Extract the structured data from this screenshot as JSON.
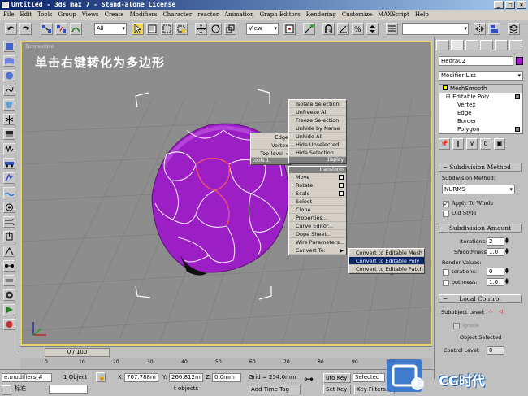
{
  "window": {
    "title": "Untitled - 3ds max 7  - Stand-alone License"
  },
  "menu": [
    "File",
    "Edit",
    "Tools",
    "Group",
    "Views",
    "Create",
    "Modifiers",
    "Character",
    "reactor",
    "Animation",
    "Graph Editors",
    "Rendering",
    "Customize",
    "MAXScript",
    "Help"
  ],
  "toolbar": {
    "selection_filter": "All",
    "reference_coord": "View"
  },
  "viewport": {
    "label": "Perspective",
    "caption": "单击右键转化为多边形"
  },
  "quad_left": [
    "Edge",
    "Vertex",
    "Top-level",
    "tools 1"
  ],
  "quad_top": [
    "Isolate Selection",
    "Unfreeze All",
    "Freeze Selection",
    "Unhide by Name",
    "Unhide All",
    "Hide Unselected",
    "Hide Selection",
    "display"
  ],
  "quad_bottom_header": "transform",
  "quad_bottom": [
    "Move",
    "Rotate",
    "Scale",
    "Select",
    "Clone",
    "Properties...",
    "Curve Editor...",
    "Dope Sheet...",
    "Wire Parameters...",
    "Convert To:"
  ],
  "submenu": [
    "Convert to Editable Mesh",
    "Convert to Editable Poly",
    "Convert to Editable Patch"
  ],
  "cmdpanel": {
    "object_name": "Hedra02",
    "object_color": "#a020c8",
    "modifier_list": "Modifier List",
    "stack": [
      "MeshSmooth",
      "Editable Poly",
      "Vertex",
      "Edge",
      "Border",
      "Polygon"
    ],
    "roll_subdivision_method": "Subdivision Method",
    "subdivision_method_label": "Subdivision Method:",
    "subdivision_method_value": "NURMS",
    "apply_to_whole": "Apply To Whole",
    "old_style": "Old Style",
    "roll_subdivision_amount": "Subdivision Amount",
    "iterations_label": "Iterations:",
    "iterations_value": "2",
    "smoothness_label": "Smoothness:",
    "smoothness_value": "1.0",
    "render_values": "Render Values:",
    "r_iterations_label": "terations:",
    "r_iterations_value": "0",
    "r_smoothness_label": "oothness:",
    "r_smoothness_value": "1.0",
    "roll_local_control": "Local Control",
    "subobject_level": "Subobject Level:",
    "ignore": "Ignore",
    "object_selected": "Object Selected",
    "control_level": "Control Level:",
    "control_level_value": "0"
  },
  "timeline": {
    "slider": "0 / 100",
    "ticks": [
      "0",
      "10",
      "20",
      "30",
      "40",
      "50",
      "60",
      "70",
      "80",
      "90",
      "100"
    ]
  },
  "status": {
    "script": "e.modifiers[#",
    "objects": "1 Object",
    "x_label": "X:",
    "x_value": "707.788m",
    "y_label": "Y:",
    "y_value": "266.812m",
    "z_label": "Z:",
    "z_value": "0.0mm",
    "grid": "Grid = 254.0mm",
    "auto_key": "uto Key",
    "selected": "Selected",
    "set_key": "Set Key",
    "key_filters": "Key Filters...",
    "prompt_left": "标准",
    "prompt_mid": "t objects",
    "add_time_tag": "Add Time Tag"
  },
  "watermark": "CG时代"
}
